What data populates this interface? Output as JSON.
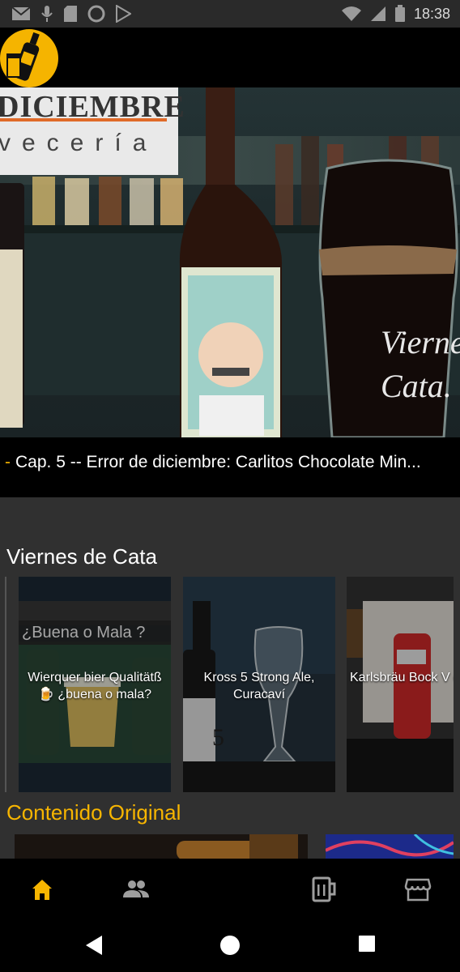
{
  "status_bar": {
    "time": "18:38",
    "icons": [
      "mail-icon",
      "mic-icon",
      "sd-card-icon",
      "circle-icon",
      "play-store-icon",
      "wifi-icon",
      "signal-icon",
      "battery-icon"
    ]
  },
  "app": {
    "logo_icon": "beer-bottle-logo-icon",
    "accent_color": "#F7B500"
  },
  "hero": {
    "brand_top": "DICIEMBRE",
    "brand_sub": "vecería",
    "overlay_line1": "Vierne",
    "overlay_line2": "Cata.",
    "caption_dash": "-",
    "caption": "Cap. 5 -- Error de diciembre: Carlitos Chocolate Min..."
  },
  "sections": {
    "viernes_title": "Viernes de Cata",
    "original_title": "Contenido Original"
  },
  "viernes_cards": [
    {
      "title": "Wierquer bier Qualitätß 🍺 ¿buena o mala?",
      "banner": "¿Buena o Mala ?"
    },
    {
      "title": "Kross 5 Strong  Ale, Curacaví",
      "bottle_label": "5"
    },
    {
      "title": "Karlsbräu Bock V de Cata."
    }
  ],
  "bottom_nav": [
    {
      "name": "home",
      "icon": "home-icon",
      "active": true
    },
    {
      "name": "community",
      "icon": "people-icon",
      "active": false
    },
    {
      "name": "beer",
      "icon": "beer-mug-icon",
      "active": false
    },
    {
      "name": "store",
      "icon": "store-icon",
      "active": false
    }
  ],
  "system_nav": [
    "back-icon",
    "home-circle-icon",
    "recents-icon"
  ]
}
